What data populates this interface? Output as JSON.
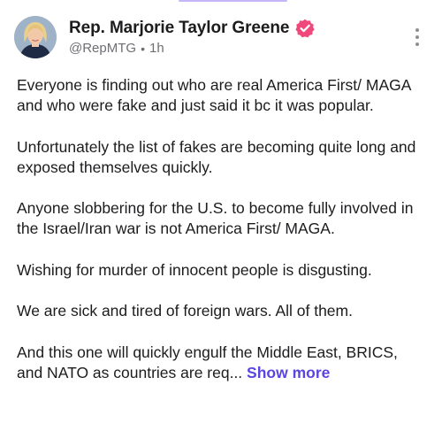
{
  "author": {
    "display_name": "Rep. Marjorie Taylor Greene",
    "handle": "@RepMTG",
    "separator": "•",
    "timestamp": "1h",
    "avatar_icon": "profile-photo",
    "verified_icon": "verified-badge-icon",
    "verified_color": "#f0487a"
  },
  "menu": {
    "icon": "more-vertical-icon"
  },
  "post": {
    "paragraphs": [
      "Everyone is finding out who are real America First/ MAGA and who were fake and just said it bc it was popular.",
      "Unfortunately the list of fakes are becoming quite long and exposed themselves quickly.",
      "Anyone slobbering for the U.S. to become fully involved in the Israel/Iran war is not America First/ MAGA.",
      "Wishing for murder of innocent people is disgusting.",
      "We are sick and tired of foreign wars. All of them."
    ],
    "truncated_paragraph": "And this one will quickly engulf the Middle East, BRICS, and NATO as countries are req...",
    "show_more_label": "Show more",
    "link_color": "#5b45e0"
  }
}
